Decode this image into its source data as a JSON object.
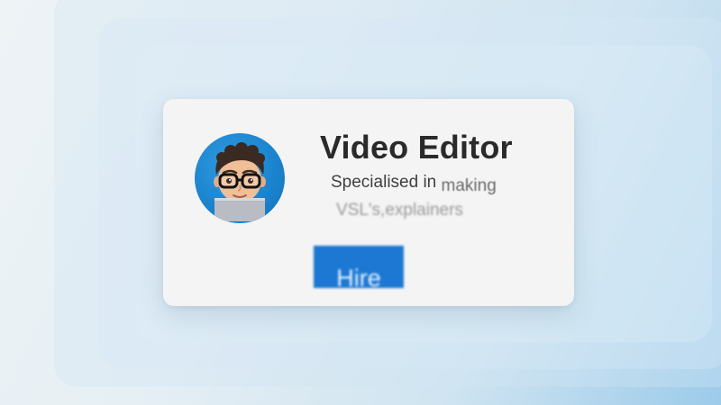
{
  "card": {
    "title": "Video Editor",
    "subtitle_line1_start": "Specialised in",
    "subtitle_line1_end": "making",
    "subtitle_line2": "VSL's,explainers",
    "button_label": "Hire"
  },
  "avatar": {
    "icon": "memoji-avatar-icon",
    "background_color": "#1a82cd"
  },
  "colors": {
    "button": "#1c78d3",
    "title": "#2a2a2a",
    "card": "#f4f4f4"
  }
}
